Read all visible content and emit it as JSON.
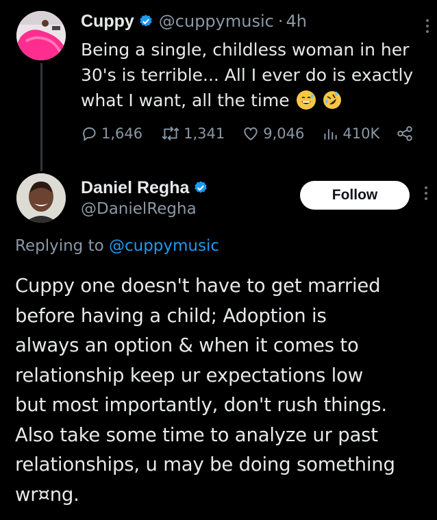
{
  "original_tweet": {
    "author_name": "Cuppy",
    "author_handle": "@cuppymusic",
    "separator": "·",
    "timestamp": "4h",
    "text": "Being a single, childless woman in her 30's is terrible... All I ever do is exactly what I want, all the time",
    "text_lines": [
      "Being a single, childless woman in her",
      "30's is terrible... All I ever do is exactly",
      "what I want, all the time"
    ],
    "emojis": [
      "grinning-sweat-emoji",
      "rolling-laughing-emoji"
    ],
    "stats": {
      "replies": "1,646",
      "reposts": "1,341",
      "likes": "9,046",
      "views": "410K"
    }
  },
  "reply_tweet": {
    "author_name": "Daniel Regha",
    "author_handle": "@DanielRegha",
    "follow_label": "Follow",
    "replying_to_prefix": "Replying to",
    "replying_to_handle": "@cuppymusic",
    "text_lines": [
      "Cuppy one doesn't have to get married",
      "before having a child; Adoption is",
      "always an option & when it comes to",
      "relationship keep ur expectations low",
      "but most importantly, don't rush things.",
      "Also take some time to analyze ur past",
      "relationships, u may be doing something",
      "wr¤ng."
    ]
  },
  "colors": {
    "background": "#000000",
    "text": "#e7e9ea",
    "muted": "#8b98a5",
    "link": "#1d9bf0",
    "verified": "#1d9bf0",
    "follow_bg": "#ffffff"
  }
}
